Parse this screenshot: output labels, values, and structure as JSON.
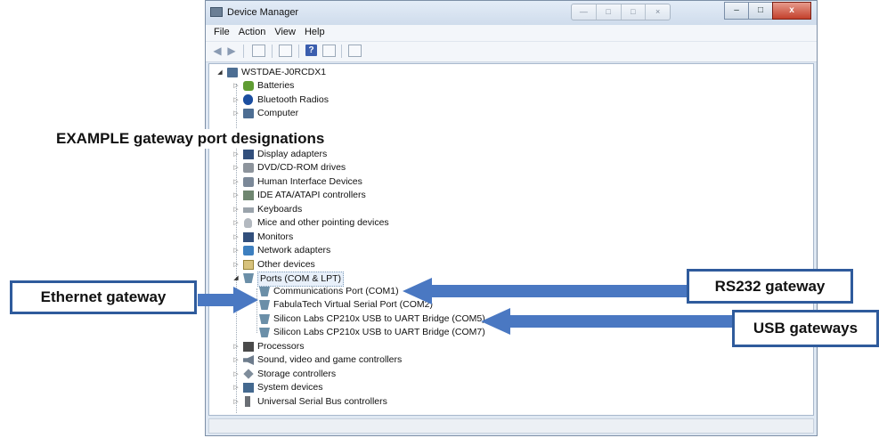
{
  "window": {
    "title": "Device Manager",
    "menu": [
      "File",
      "Action",
      "View",
      "Help"
    ],
    "caption_buttons": {
      "minimize": "–",
      "maximize": "□",
      "close": "x"
    }
  },
  "tree": {
    "root": "WSTDAE-J0RCDX1",
    "items": [
      {
        "label": "Batteries",
        "icon": "battery-icon"
      },
      {
        "label": "Bluetooth Radios",
        "icon": "bluetooth-icon"
      },
      {
        "label": "Computer",
        "icon": "computer-icon"
      },
      {
        "label": "Display adapters",
        "icon": "display-adapter-icon"
      },
      {
        "label": "DVD/CD-ROM drives",
        "icon": "dvd-drive-icon"
      },
      {
        "label": "Human Interface Devices",
        "icon": "hid-icon"
      },
      {
        "label": "IDE ATA/ATAPI controllers",
        "icon": "ide-controller-icon"
      },
      {
        "label": "Keyboards",
        "icon": "keyboard-icon"
      },
      {
        "label": "Mice and other pointing devices",
        "icon": "mouse-icon"
      },
      {
        "label": "Monitors",
        "icon": "monitor-icon"
      },
      {
        "label": "Network adapters",
        "icon": "network-adapter-icon"
      },
      {
        "label": "Other devices",
        "icon": "other-devices-icon"
      },
      {
        "label": "Ports (COM & LPT)",
        "icon": "port-icon"
      },
      {
        "label": "Processors",
        "icon": "processor-icon"
      },
      {
        "label": "Sound, video and game controllers",
        "icon": "sound-icon"
      },
      {
        "label": "Storage controllers",
        "icon": "storage-icon"
      },
      {
        "label": "System devices",
        "icon": "system-device-icon"
      },
      {
        "label": "Universal Serial Bus controllers",
        "icon": "usb-icon"
      }
    ],
    "ports": [
      "Communications Port (COM1)",
      "FabulaTech Virtual Serial Port (COM2)",
      "Silicon Labs CP210x USB to UART Bridge (COM5)",
      "Silicon Labs CP210x USB to UART Bridge (COM7)"
    ]
  },
  "annotations": {
    "headline": "EXAMPLE gateway port designations",
    "ethernet": "Ethernet gateway",
    "rs232": "RS232 gateway",
    "usb": "USB gateways",
    "callout_color": "#2f5b9c",
    "arrow_color": "#4a78c2"
  }
}
